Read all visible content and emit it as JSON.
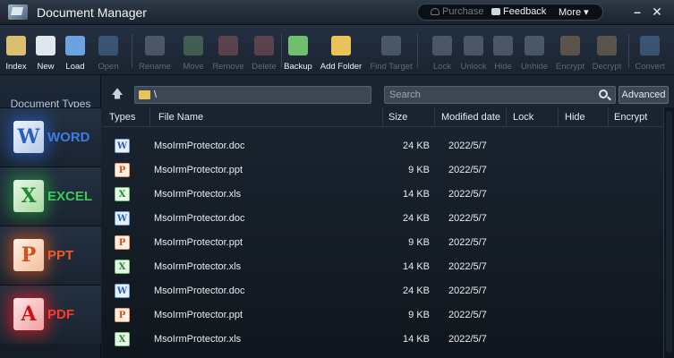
{
  "title": "Document Manager",
  "header": {
    "purchase": "Purchase",
    "feedback": "Feedback",
    "more": "More ▾"
  },
  "toolbar": [
    {
      "label": "Index",
      "enabled": true
    },
    {
      "label": "New",
      "enabled": true
    },
    {
      "label": "Load",
      "enabled": true
    },
    {
      "label": "Open",
      "enabled": false
    },
    {
      "label": "Rename",
      "enabled": false
    },
    {
      "label": "Move",
      "enabled": false
    },
    {
      "label": "Remove",
      "enabled": false
    },
    {
      "label": "Delete",
      "enabled": false
    },
    {
      "label": "Backup",
      "enabled": true
    },
    {
      "label": "Add Folder",
      "enabled": true
    },
    {
      "label": "Find Target",
      "enabled": false
    },
    {
      "label": "Lock",
      "enabled": false
    },
    {
      "label": "Unlock",
      "enabled": false
    },
    {
      "label": "Hide",
      "enabled": false
    },
    {
      "label": "Unhide",
      "enabled": false
    },
    {
      "label": "Encrypt",
      "enabled": false
    },
    {
      "label": "Decrypt",
      "enabled": false
    },
    {
      "label": "Convert",
      "enabled": false
    }
  ],
  "sidebar": {
    "title": "Document Types",
    "types": [
      {
        "label": "WORD",
        "icon": "W"
      },
      {
        "label": "EXCEL",
        "icon": "X"
      },
      {
        "label": "PPT",
        "icon": "P"
      },
      {
        "label": "PDF",
        "icon": "A"
      }
    ]
  },
  "nav": {
    "path": "\\",
    "search_placeholder": "Search",
    "advanced": "Advanced"
  },
  "table": {
    "columns": [
      "Types",
      "File Name",
      "Size",
      "Modified date",
      "Lock",
      "Hide",
      "Encrypt"
    ],
    "rows": [
      {
        "type": "doc",
        "icon": "W",
        "name": "MsoIrmProtector.doc",
        "size": "24 KB",
        "date": "2022/5/7"
      },
      {
        "type": "ppt",
        "icon": "P",
        "name": "MsoIrmProtector.ppt",
        "size": "9 KB",
        "date": "2022/5/7"
      },
      {
        "type": "xls",
        "icon": "X",
        "name": "MsoIrmProtector.xls",
        "size": "14 KB",
        "date": "2022/5/7"
      },
      {
        "type": "doc",
        "icon": "W",
        "name": "MsoIrmProtector.doc",
        "size": "24 KB",
        "date": "2022/5/7"
      },
      {
        "type": "ppt",
        "icon": "P",
        "name": "MsoIrmProtector.ppt",
        "size": "9 KB",
        "date": "2022/5/7"
      },
      {
        "type": "xls",
        "icon": "X",
        "name": "MsoIrmProtector.xls",
        "size": "14 KB",
        "date": "2022/5/7"
      },
      {
        "type": "doc",
        "icon": "W",
        "name": "MsoIrmProtector.doc",
        "size": "24 KB",
        "date": "2022/5/7"
      },
      {
        "type": "ppt",
        "icon": "P",
        "name": "MsoIrmProtector.ppt",
        "size": "9 KB",
        "date": "2022/5/7"
      },
      {
        "type": "xls",
        "icon": "X",
        "name": "MsoIrmProtector.xls",
        "size": "14 KB",
        "date": "2022/5/7"
      }
    ]
  }
}
